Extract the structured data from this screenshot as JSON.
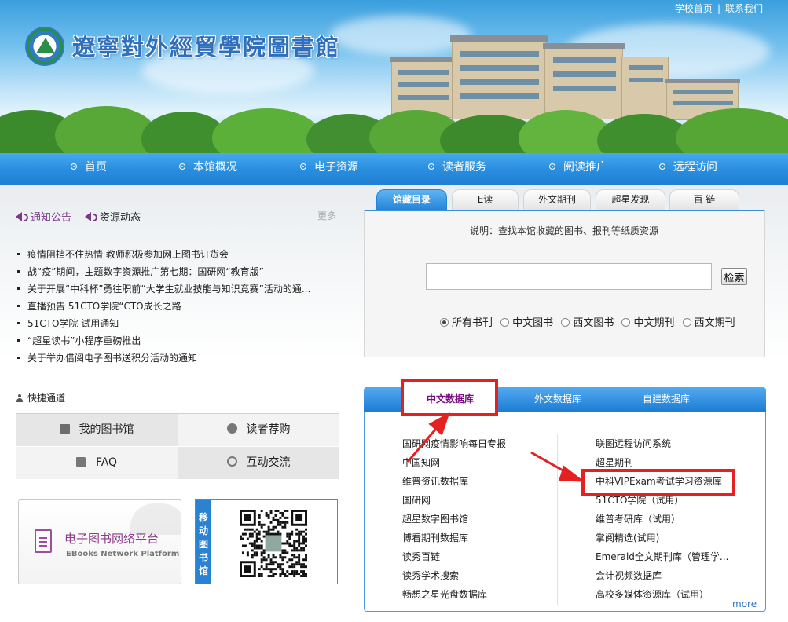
{
  "header": {
    "title": "遼寧對外經貿學院圖書館",
    "top_links": [
      "学校首页",
      "联系我们"
    ]
  },
  "nav": {
    "items": [
      "首页",
      "本馆概况",
      "电子资源",
      "读者服务",
      "阅读推广",
      "远程访问"
    ]
  },
  "news": {
    "tabs": [
      "通知公告",
      "资源动态"
    ],
    "more": "更多",
    "items": [
      "疫情阻挡不住热情 教师积极参加网上图书订货会",
      "战“疫”期间，主题数字资源推广第七期：国研网“教育版”",
      "关于开展“中科杯”勇往职前“大学生就业技能与知识竞赛”活动的通...",
      "直播预告 51CTO学院“CTO成长之路",
      "51CTO学院 试用通知",
      "“超星读书”小程序重磅推出",
      "关于举办借阅电子图书送积分活动的通知"
    ]
  },
  "quick": {
    "title": "快捷通道",
    "items": [
      "我的图书馆",
      "读者荐购",
      "FAQ",
      "互动交流"
    ]
  },
  "banners": {
    "ebook_title": "电子图书网络平台",
    "ebook_subtitle": "EBooks Network Platform",
    "mobile_label": "移动图书馆"
  },
  "catalog": {
    "tabs": [
      "馆藏目录",
      "E读",
      "外文期刊",
      "超星发现",
      "百 链"
    ],
    "active_tab": 0,
    "description": "说明：查找本馆收藏的图书、报刊等纸质资源",
    "search_value": "",
    "search_button": "检索",
    "radio_options": [
      "所有书刊",
      "中文图书",
      "西文图书",
      "中文期刊",
      "西文期刊"
    ],
    "selected_option": 0
  },
  "databases": {
    "tabs": [
      "中文数据库",
      "外文数据库",
      "自建数据库"
    ],
    "active_tab": 0,
    "left_column": [
      "国研网疫情影响每日专报",
      "中国知网",
      "维普资讯数据库",
      "国研网",
      "超星数字图书馆",
      "博看期刊数据库",
      "读秀百链",
      "读秀学术搜索",
      "畅想之星光盘数据库"
    ],
    "right_column": [
      "联图远程访问系统",
      "超星期刊",
      "中科VIPExam考试学习资源库",
      "51CTO学院（试用）",
      "维普考研库（试用）",
      "掌阅精选(试用)",
      "Emerald全文期刊库（管理学...",
      "会计视频数据库",
      "高校多媒体资源库（试用）"
    ],
    "more": "more"
  },
  "annotation_color": "#e42020",
  "accent_color": "#2a8fe0"
}
